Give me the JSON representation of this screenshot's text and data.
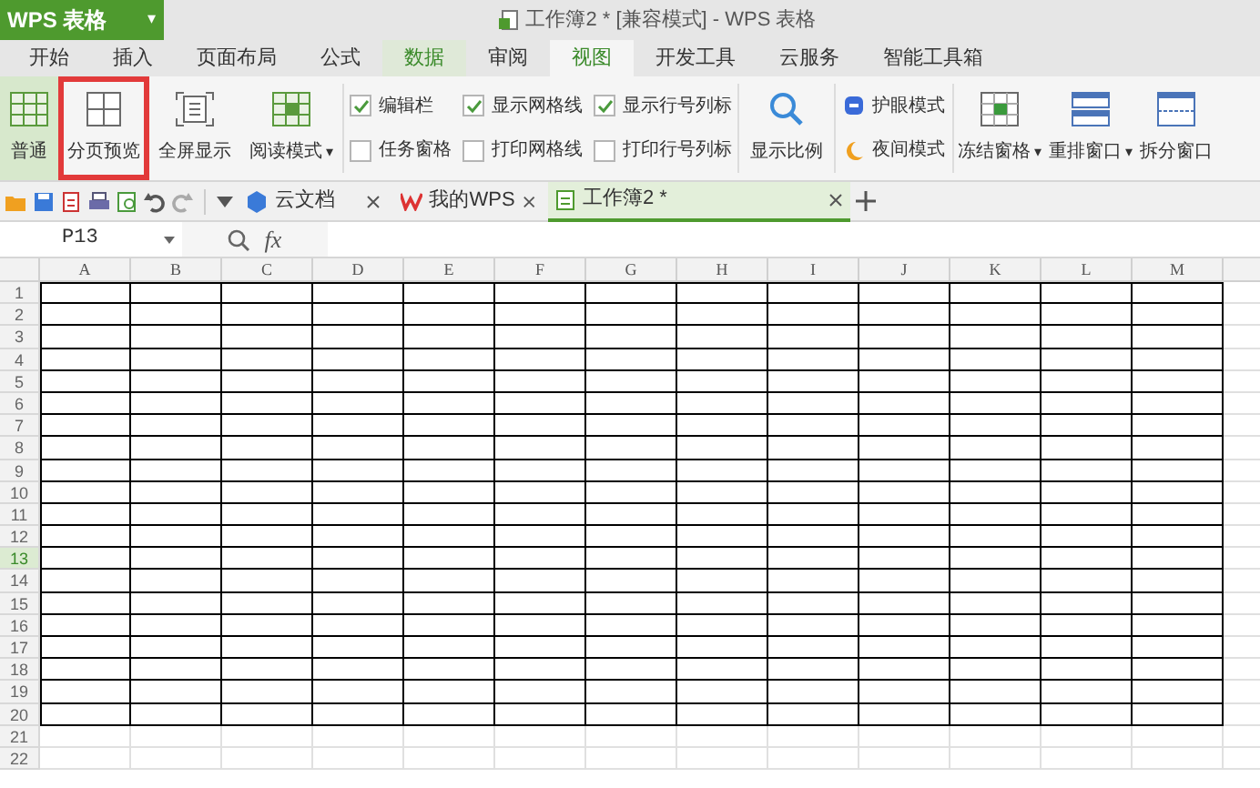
{
  "app_menu": {
    "label": "WPS 表格",
    "caret": "▾"
  },
  "window": {
    "title": "工作簿2 * [兼容模式] - WPS 表格"
  },
  "ribbon_tabs": [
    {
      "label": "开始",
      "selected": false,
      "hovered": false
    },
    {
      "label": "插入",
      "selected": false,
      "hovered": false
    },
    {
      "label": "页面布局",
      "selected": false,
      "hovered": false
    },
    {
      "label": "公式",
      "selected": false,
      "hovered": false
    },
    {
      "label": "数据",
      "selected": false,
      "hovered": true
    },
    {
      "label": "审阅",
      "selected": false,
      "hovered": false
    },
    {
      "label": "视图",
      "selected": true,
      "hovered": false
    },
    {
      "label": "开发工具",
      "selected": false,
      "hovered": false
    },
    {
      "label": "云服务",
      "selected": false,
      "hovered": false
    },
    {
      "label": "智能工具箱",
      "selected": false,
      "hovered": false
    }
  ],
  "view_buttons": [
    {
      "label": "普通",
      "kind": "normal",
      "selected": true,
      "highlighted": false
    },
    {
      "label": "分页预览",
      "kind": "pagebreak",
      "selected": false,
      "highlighted": true
    },
    {
      "label": "全屏显示",
      "kind": "fullscreen",
      "selected": false,
      "highlighted": false
    },
    {
      "label": "阅读模式",
      "kind": "reading",
      "selected": false,
      "highlighted": false,
      "caret": "▾"
    }
  ],
  "checkbox_columns": [
    [
      {
        "label": "编辑栏",
        "checked": true
      },
      {
        "label": "任务窗格",
        "checked": false
      }
    ],
    [
      {
        "label": "显示网格线",
        "checked": true
      },
      {
        "label": "打印网格线",
        "checked": false
      }
    ],
    [
      {
        "label": "显示行号列标",
        "checked": true
      },
      {
        "label": "打印行号列标",
        "checked": false
      }
    ]
  ],
  "zoom_button": {
    "label": "显示比例"
  },
  "mode_buttons": [
    {
      "label": "护眼模式",
      "kind": "eye"
    },
    {
      "label": "夜间模式",
      "kind": "night"
    }
  ],
  "window_buttons": [
    {
      "label": "冻结窗格",
      "kind": "freeze",
      "caret": "▾"
    },
    {
      "label": "重排窗口",
      "kind": "arrange",
      "caret": "▾"
    },
    {
      "label": "拆分窗口",
      "kind": "split"
    }
  ],
  "doc_tabs": [
    {
      "label": "云文档",
      "kind": "cloud",
      "selected": false
    },
    {
      "label": "我的WPS",
      "kind": "wps",
      "selected": false
    },
    {
      "label": "工作簿2 *",
      "kind": "sheet",
      "selected": true
    }
  ],
  "formula_bar": {
    "cell_ref": "P13",
    "fx": "fx"
  },
  "columns": [
    "A",
    "B",
    "C",
    "D",
    "E",
    "F",
    "G",
    "H",
    "I",
    "J",
    "K",
    "L",
    "M"
  ],
  "rows": [
    {
      "label": "1",
      "selected": false,
      "bordered": true
    },
    {
      "label": "2",
      "selected": false,
      "bordered": true
    },
    {
      "label": "3",
      "selected": false,
      "bordered": true
    },
    {
      "label": "4",
      "selected": false,
      "bordered": true
    },
    {
      "label": "5",
      "selected": false,
      "bordered": true
    },
    {
      "label": "6",
      "selected": false,
      "bordered": true
    },
    {
      "label": "7",
      "selected": false,
      "bordered": true
    },
    {
      "label": "8",
      "selected": false,
      "bordered": true
    },
    {
      "label": "9",
      "selected": false,
      "bordered": true
    },
    {
      "label": "10",
      "selected": false,
      "bordered": true
    },
    {
      "label": "11",
      "selected": false,
      "bordered": true
    },
    {
      "label": "12",
      "selected": false,
      "bordered": true
    },
    {
      "label": "13",
      "selected": true,
      "bordered": true
    },
    {
      "label": "14",
      "selected": false,
      "bordered": true
    },
    {
      "label": "15",
      "selected": false,
      "bordered": true
    },
    {
      "label": "16",
      "selected": false,
      "bordered": true
    },
    {
      "label": "17",
      "selected": false,
      "bordered": true
    },
    {
      "label": "18",
      "selected": false,
      "bordered": true
    },
    {
      "label": "19",
      "selected": false,
      "bordered": true
    },
    {
      "label": "20",
      "selected": false,
      "bordered": true
    },
    {
      "label": "21",
      "selected": false,
      "bordered": false
    },
    {
      "label": "22",
      "selected": false,
      "bordered": false
    }
  ]
}
